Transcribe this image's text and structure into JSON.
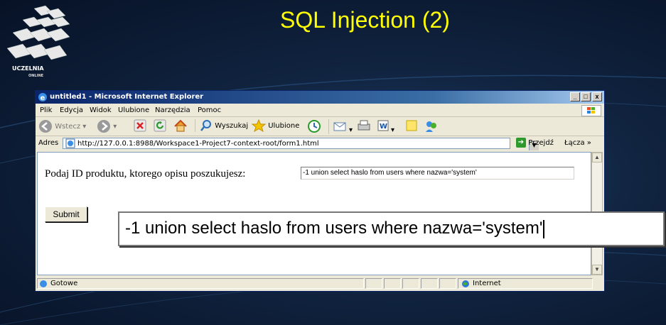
{
  "slide": {
    "title": "SQL Injection (2)",
    "logo_text": "UCZELNIA",
    "logo_subtext": "ONLINE"
  },
  "browser": {
    "window_title": "untitled1 - Microsoft Internet Explorer",
    "title_buttons": [
      "_",
      "□",
      "x"
    ],
    "menu": [
      "Plik",
      "Edycja",
      "Widok",
      "Ulubione",
      "Narzędzia",
      "Pomoc"
    ],
    "toolbar": {
      "back_label": "Wstecz",
      "search_label": "Wyszukaj",
      "favorites_label": "Ulubione"
    },
    "address": {
      "label": "Adres",
      "url": "http://127.0.0.1:8988/Workspace1-Project7-context-root/form1.html",
      "go_label": "Przejdź",
      "links_label": "Łącza"
    },
    "page": {
      "prompt": "Podaj ID produktu, ktorego opisu poszukujesz:",
      "input_value": "-1 union select haslo from users where nazwa='system'",
      "submit_label": "Submit"
    },
    "status": {
      "text": "Gotowe",
      "zone": "Internet"
    }
  },
  "zoom_callout": {
    "value": "-1 union select haslo from users where nazwa='system'"
  }
}
